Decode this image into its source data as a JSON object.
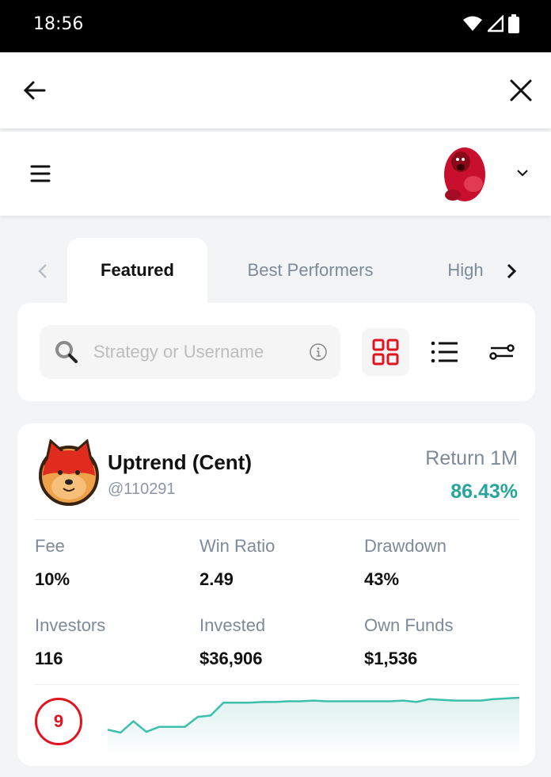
{
  "status_bar": {
    "time": "18:56",
    "icons": [
      "wifi-icon",
      "signal-icon",
      "battery-icon"
    ]
  },
  "topbar": {
    "back": "back-arrow-icon",
    "close": "close-icon"
  },
  "appbar": {
    "menu": "hamburger-menu-icon",
    "account_avatar": "bear-avatar",
    "account_dropdown": "chevron-down-icon"
  },
  "tabs": {
    "items": [
      {
        "label": "Featured",
        "active": true
      },
      {
        "label": "Best Performers",
        "active": false
      },
      {
        "label": "High",
        "active": false
      }
    ]
  },
  "search": {
    "placeholder": "Strategy or Username",
    "value": ""
  },
  "view_options": [
    {
      "name": "grid-view",
      "active": true
    },
    {
      "name": "list-view",
      "active": false
    },
    {
      "name": "filter-settings",
      "active": false
    }
  ],
  "colors": {
    "accent": "#e0141e",
    "positive": "#26a69a",
    "muted": "#7d8a9a"
  },
  "strategy_card": {
    "name": "Uptrend (Cent)",
    "username": "@110291",
    "return_label": "Return 1M",
    "return_value": "86.43%",
    "stats": [
      {
        "label": "Fee",
        "value": "10%"
      },
      {
        "label": "Win Ratio",
        "value": "2.49"
      },
      {
        "label": "Drawdown",
        "value": "43%"
      },
      {
        "label": "Investors",
        "value": "116"
      },
      {
        "label": "Invested",
        "value": "$36,906"
      },
      {
        "label": "Own Funds",
        "value": "$1,536"
      }
    ],
    "risk_score": "9",
    "sparkline": [
      40,
      36,
      52,
      37,
      44,
      44,
      44,
      58,
      60,
      78,
      78,
      78,
      79,
      79,
      80,
      80,
      81,
      80,
      80,
      80,
      80,
      80,
      80,
      81,
      79,
      83,
      82,
      81,
      81,
      81,
      83,
      84,
      85
    ]
  }
}
